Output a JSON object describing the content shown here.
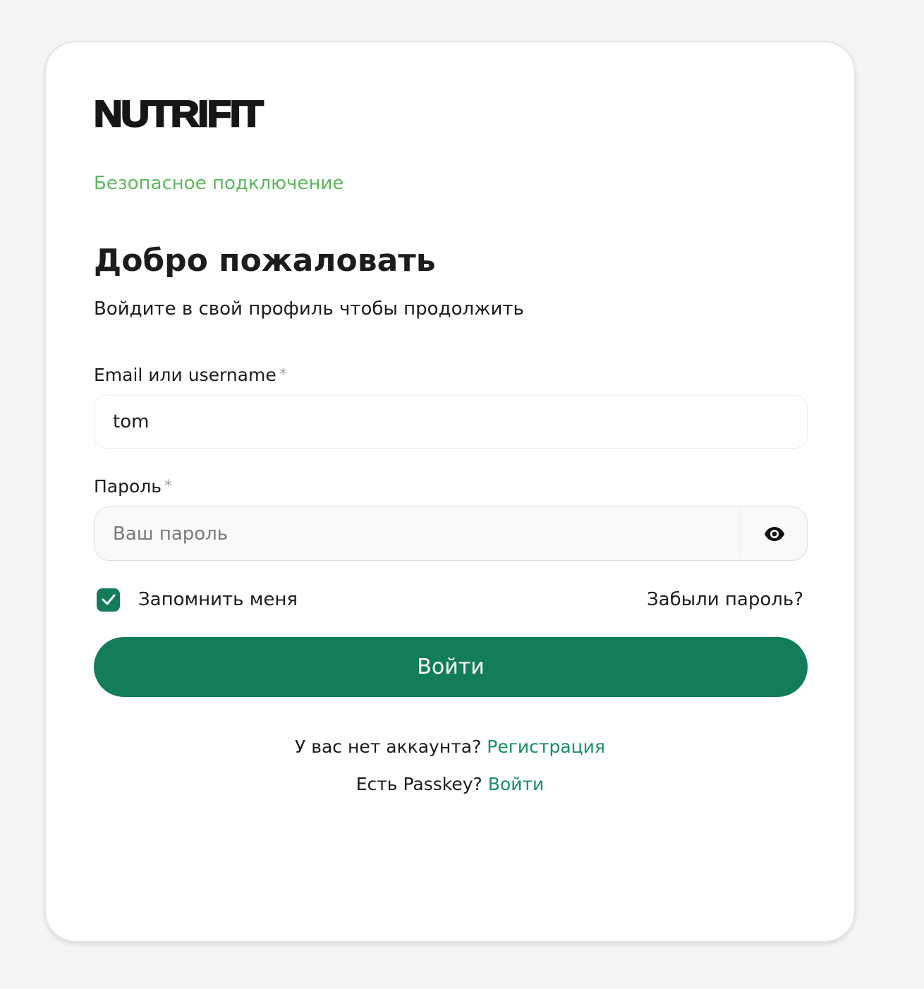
{
  "brand": {
    "logo_text": "NUTRIFIT"
  },
  "secure_connection": "Безопасное подключение",
  "heading": {
    "title": "Добро пожаловать",
    "subtitle": "Войдите в свой профиль чтобы продолжить"
  },
  "form": {
    "email_label": "Email или username",
    "email_value": "tom",
    "password_label": "Пароль",
    "password_placeholder": "Ваш пароль",
    "required_mark": "*",
    "remember_label": "Запомнить меня",
    "remember_checked": true,
    "forgot_link": "Забыли пароль?",
    "submit_label": "Войти"
  },
  "footer": {
    "no_account_text": "У вас нет аккаунта? ",
    "register_link": "Регистрация",
    "passkey_text": "Есть Passkey? ",
    "passkey_link": "Войти"
  },
  "icons": {
    "password_toggle": "eye-icon",
    "checkbox_mark": "checkmark-icon"
  },
  "colors": {
    "primary": "#137d58",
    "link": "#149060",
    "secure": "#5cb85c",
    "background": "#f4f5f7"
  }
}
